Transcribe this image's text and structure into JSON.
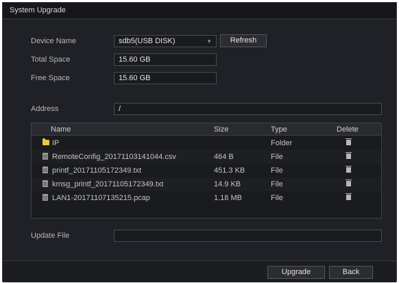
{
  "window": {
    "title": "System Upgrade"
  },
  "device": {
    "label": "Device Name",
    "value": "sdb5(USB DISK)",
    "refresh_label": "Refresh"
  },
  "total_space": {
    "label": "Total Space",
    "value": "15.60 GB"
  },
  "free_space": {
    "label": "Free Space",
    "value": "15.60 GB"
  },
  "address": {
    "label": "Address",
    "value": "/"
  },
  "file_table": {
    "columns": {
      "name": "Name",
      "size": "Size",
      "type": "Type",
      "delete": "Delete"
    },
    "rows": [
      {
        "name": "IP",
        "size": "",
        "type": "Folder",
        "icon": "folder-icon"
      },
      {
        "name": "RemoteConfig_20171103141044.csv",
        "size": "464 B",
        "type": "File",
        "icon": "file-icon"
      },
      {
        "name": "printf_20171105172349.txt",
        "size": "451.3 KB",
        "type": "File",
        "icon": "file-icon"
      },
      {
        "name": "kmsg_printf_20171105172349.txt",
        "size": "14.9 KB",
        "type": "File",
        "icon": "file-icon"
      },
      {
        "name": "LAN1-20171107135215.pcap",
        "size": "1.18 MB",
        "type": "File",
        "icon": "file-icon"
      }
    ]
  },
  "update_file": {
    "label": "Update File",
    "value": ""
  },
  "actions": {
    "upgrade_label": "Upgrade",
    "back_label": "Back"
  },
  "colors": {
    "background": "#202126",
    "titlebar": "#16171b",
    "folder": "#e6c84a"
  }
}
